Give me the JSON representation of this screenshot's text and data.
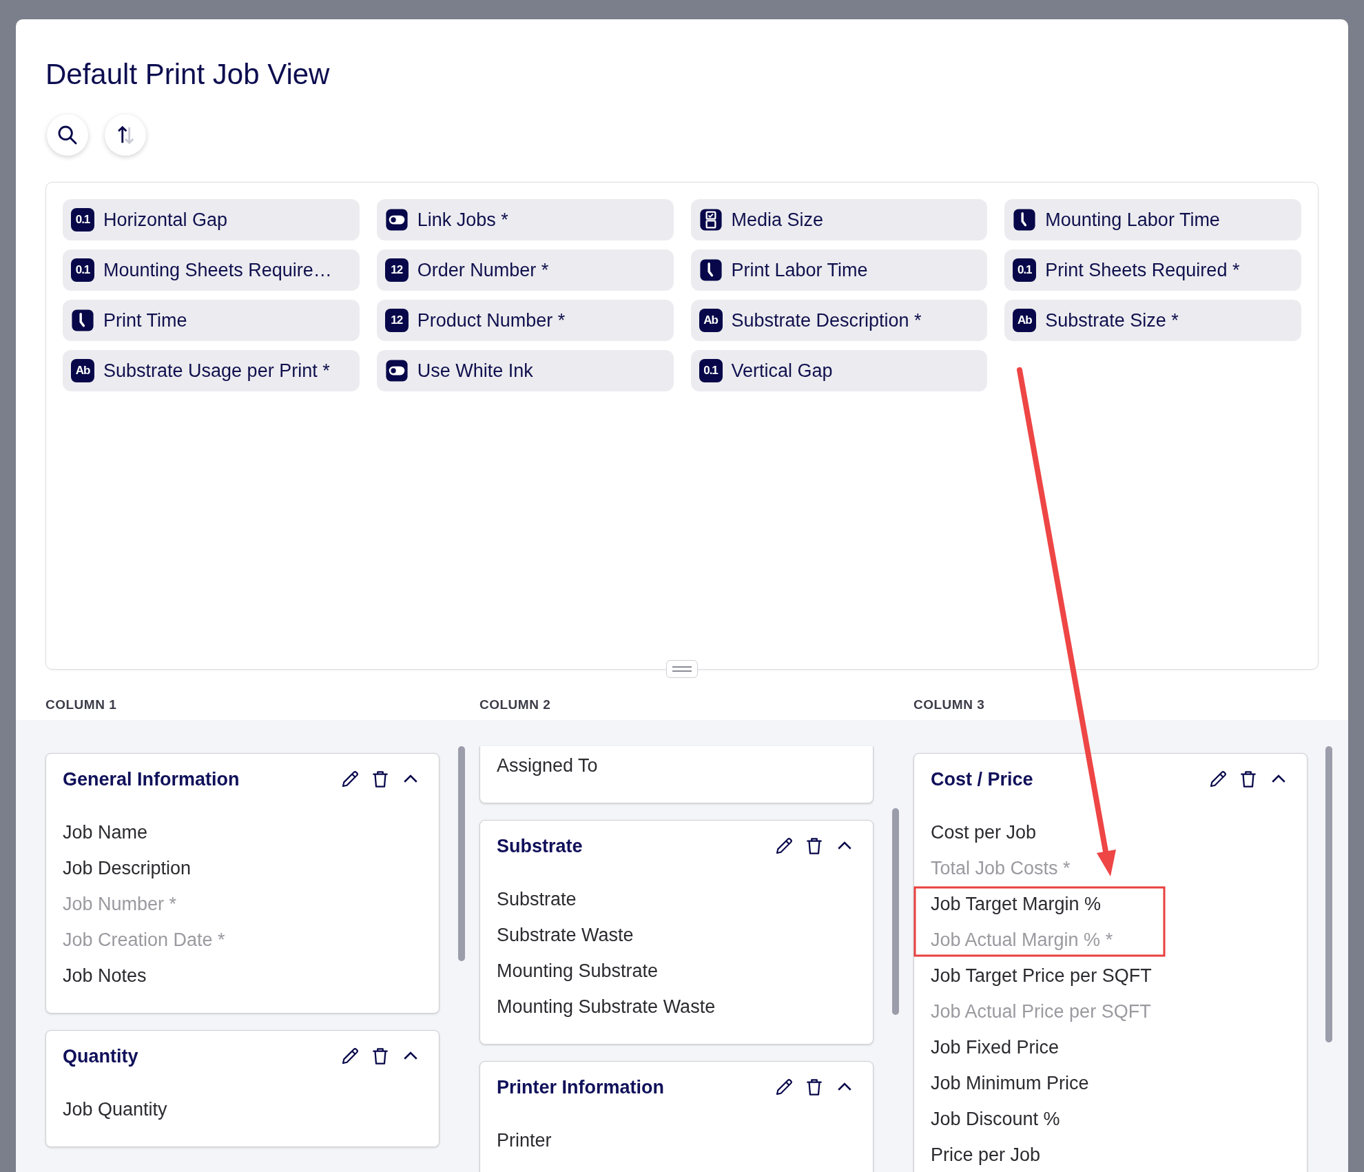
{
  "title": "Default Print Job View",
  "toolbar": [
    {
      "kind": "search"
    },
    {
      "kind": "sort"
    }
  ],
  "fields": [
    {
      "kind": "decimal",
      "badge": "0.1",
      "label": "Horizontal Gap"
    },
    {
      "kind": "toggle",
      "label": "Link Jobs *"
    },
    {
      "kind": "select",
      "label": "Media Size"
    },
    {
      "kind": "time",
      "label": "Mounting Labor Time"
    },
    {
      "kind": "decimal",
      "badge": "0.1",
      "label": "Mounting Sheets Require…"
    },
    {
      "kind": "integer",
      "badge": "12",
      "label": "Order Number *"
    },
    {
      "kind": "time",
      "label": "Print Labor Time"
    },
    {
      "kind": "decimal",
      "badge": "0.1",
      "label": "Print Sheets Required *"
    },
    {
      "kind": "time",
      "label": "Print Time"
    },
    {
      "kind": "integer",
      "badge": "12",
      "label": "Product Number *"
    },
    {
      "kind": "text",
      "badge": "Ab",
      "label": "Substrate Description *"
    },
    {
      "kind": "text",
      "badge": "Ab",
      "label": "Substrate Size *"
    },
    {
      "kind": "text",
      "badge": "Ab",
      "label": "Substrate Usage per Print *"
    },
    {
      "kind": "toggle",
      "label": "Use White Ink"
    },
    {
      "kind": "decimal",
      "badge": "0.1",
      "label": "Vertical Gap"
    }
  ],
  "columns": [
    {
      "label": "COLUMN 1",
      "groups": [
        {
          "title": "General Information",
          "expanded": true,
          "items": [
            {
              "label": "Job Name",
              "disabled": false
            },
            {
              "label": "Job Description",
              "disabled": false
            },
            {
              "label": "Job Number *",
              "disabled": true
            },
            {
              "label": "Job Creation Date *",
              "disabled": true
            },
            {
              "label": "Job Notes",
              "disabled": false
            }
          ]
        },
        {
          "title": "Quantity",
          "expanded": true,
          "items": [
            {
              "label": "Job Quantity",
              "disabled": false
            }
          ]
        }
      ]
    },
    {
      "label": "COLUMN 2",
      "groups": [
        {
          "items": [
            {
              "label": "Assigned To",
              "disabled": false
            }
          ]
        },
        {
          "title": "Substrate",
          "expanded": true,
          "items": [
            {
              "label": "Substrate",
              "disabled": false
            },
            {
              "label": "Substrate Waste",
              "disabled": false
            },
            {
              "label": "Mounting Substrate",
              "disabled": false
            },
            {
              "label": "Mounting Substrate Waste",
              "disabled": false
            }
          ]
        },
        {
          "title": "Printer Information",
          "expanded": true,
          "items": [
            {
              "label": "Printer",
              "disabled": false
            }
          ]
        }
      ]
    },
    {
      "label": "COLUMN 3",
      "groups": [
        {
          "title": "Cost / Price",
          "expanded": true,
          "items": [
            {
              "label": "Cost per Job",
              "disabled": false
            },
            {
              "label": "Total Job Costs *",
              "disabled": true
            },
            {
              "label": "Job Target Margin %",
              "disabled": false
            },
            {
              "label": "Job Actual Margin % *",
              "disabled": true
            },
            {
              "label": "Job Target Price per SQFT",
              "disabled": false
            },
            {
              "label": "Job Actual Price per SQFT",
              "disabled": true
            },
            {
              "label": "Job Fixed Price",
              "disabled": false
            },
            {
              "label": "Job Minimum Price",
              "disabled": false
            },
            {
              "label": "Job Discount %",
              "disabled": false
            },
            {
              "label": "Price per Job",
              "disabled": false
            }
          ]
        }
      ]
    }
  ]
}
